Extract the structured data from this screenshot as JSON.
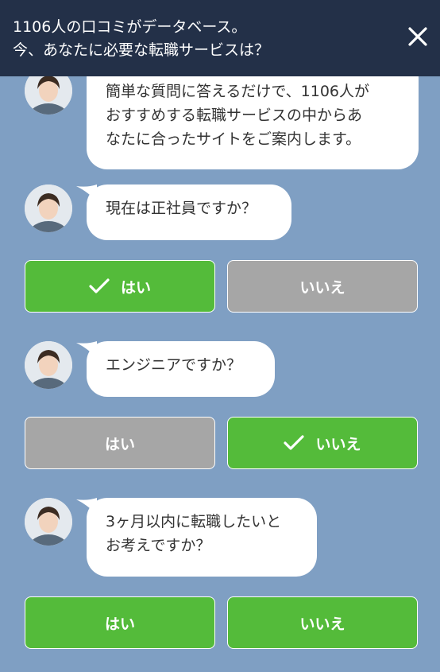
{
  "header": {
    "title_line1": "1106人の口コミがデータベース。",
    "title_line2": "今、あなたに必要な転職サービスは？",
    "close_icon": "close-icon"
  },
  "colors": {
    "header_bg": "#233048",
    "background": "#7f9fc3",
    "selected": "#54bb3a",
    "unselected": "#a6a6a6",
    "bubble": "#ffffff"
  },
  "messages": [
    {
      "avatar": "advisor-avatar",
      "lines": [
        "簡単な質問に答えるだけで、1106人が",
        "おすすめする転職サービスの中からあ",
        "なたに合ったサイトをご案内します。"
      ]
    },
    {
      "avatar": "advisor-avatar",
      "lines": [
        "現在は正社員ですか？"
      ],
      "yes_label": "はい",
      "no_label": "いいえ",
      "selected": "yes"
    },
    {
      "avatar": "advisor-avatar",
      "lines": [
        "エンジニアですか？"
      ],
      "yes_label": "はい",
      "no_label": "いいえ",
      "selected": "no"
    },
    {
      "avatar": "advisor-avatar",
      "lines": [
        "3ヶ月以内に転職したいと",
        "お考えですか？"
      ],
      "yes_label": "はい",
      "no_label": "いいえ",
      "selected": "none"
    }
  ]
}
